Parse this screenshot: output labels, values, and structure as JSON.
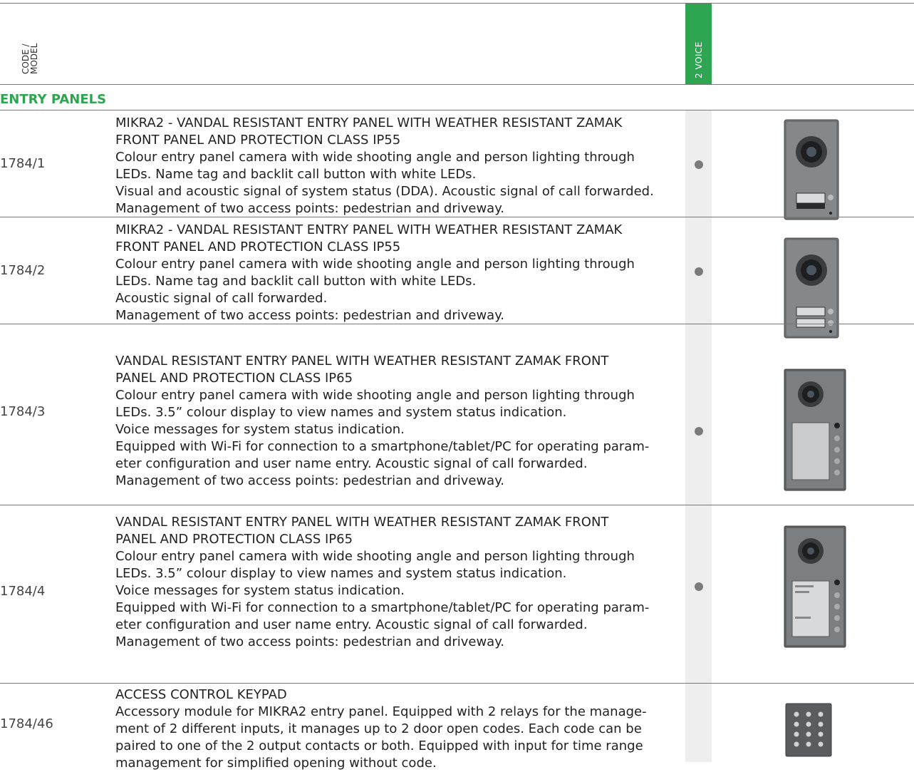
{
  "header": {
    "code_model_label": "CODE /\nMODEL",
    "column_label": "2 VOICE",
    "accent_color": "#2ea550"
  },
  "section": {
    "title": "ENTRY PANELS"
  },
  "rows": [
    {
      "code": "1784/1",
      "lines": [
        "MIKRA2 - VANDAL RESISTANT ENTRY PANEL WITH WEATHER RESISTANT ZAMAK",
        "FRONT PANEL AND PROTECTION CLASS IP55",
        "Colour entry panel camera with wide shooting angle and person lighting through",
        "LEDs. Name tag and backlit call button with white LEDs.",
        "Visual and acoustic signal of system status (DDA). Acoustic signal of call forwarded.",
        "Management of two access points: pedestrian and driveway."
      ],
      "mark": "●"
    },
    {
      "code": "1784/2",
      "lines": [
        "MIKRA2 - VANDAL RESISTANT ENTRY PANEL WITH WEATHER RESISTANT ZAMAK",
        "FRONT PANEL AND PROTECTION CLASS IP55",
        "Colour entry panel camera with wide shooting angle and person lighting through",
        "LEDs. Name tag and backlit call button with white LEDs.",
        "Acoustic signal of call forwarded.",
        "Management of two access points: pedestrian and driveway."
      ],
      "mark": "●"
    },
    {
      "code": "1784/3",
      "lines": [
        "VANDAL RESISTANT ENTRY PANEL WITH WEATHER RESISTANT ZAMAK FRONT",
        "PANEL AND PROTECTION CLASS IP65",
        "Colour entry panel camera with wide shooting angle and person lighting through",
        "LEDs. 3.5” colour display to view names and system status indication.",
        "Voice messages for system status indication.",
        "Equipped with Wi-Fi for connection to a smartphone/tablet/PC for operating param-",
        "eter configuration and user name entry. Acoustic signal of call forwarded.",
        "Management of two access points: pedestrian and driveway."
      ],
      "mark": "●"
    },
    {
      "code": "1784/4",
      "lines": [
        "VANDAL RESISTANT ENTRY PANEL WITH WEATHER RESISTANT ZAMAK FRONT",
        "PANEL AND PROTECTION CLASS IP65",
        "Colour entry panel camera with wide shooting angle and person lighting through",
        "LEDs. 3.5” colour display to view names and system status indication.",
        "Voice messages for system status indication.",
        "Equipped with Wi-Fi for connection to a smartphone/tablet/PC for operating param-",
        "eter configuration and user name entry. Acoustic signal of call forwarded.",
        "Management of two access points: pedestrian and driveway."
      ],
      "mark": "●"
    },
    {
      "code": "1784/46",
      "lines": [
        "ACCESS CONTROL KEYPAD",
        "Accessory module for MIKRA2 entry panel. Equipped with 2 relays for the manage-",
        "ment of 2 different inputs, it manages up to 2 door open codes. Each code can be",
        "paired to one of the 2 output contacts or both. Equipped with input for time range",
        "management for simplified opening without code."
      ],
      "mark": ""
    }
  ]
}
